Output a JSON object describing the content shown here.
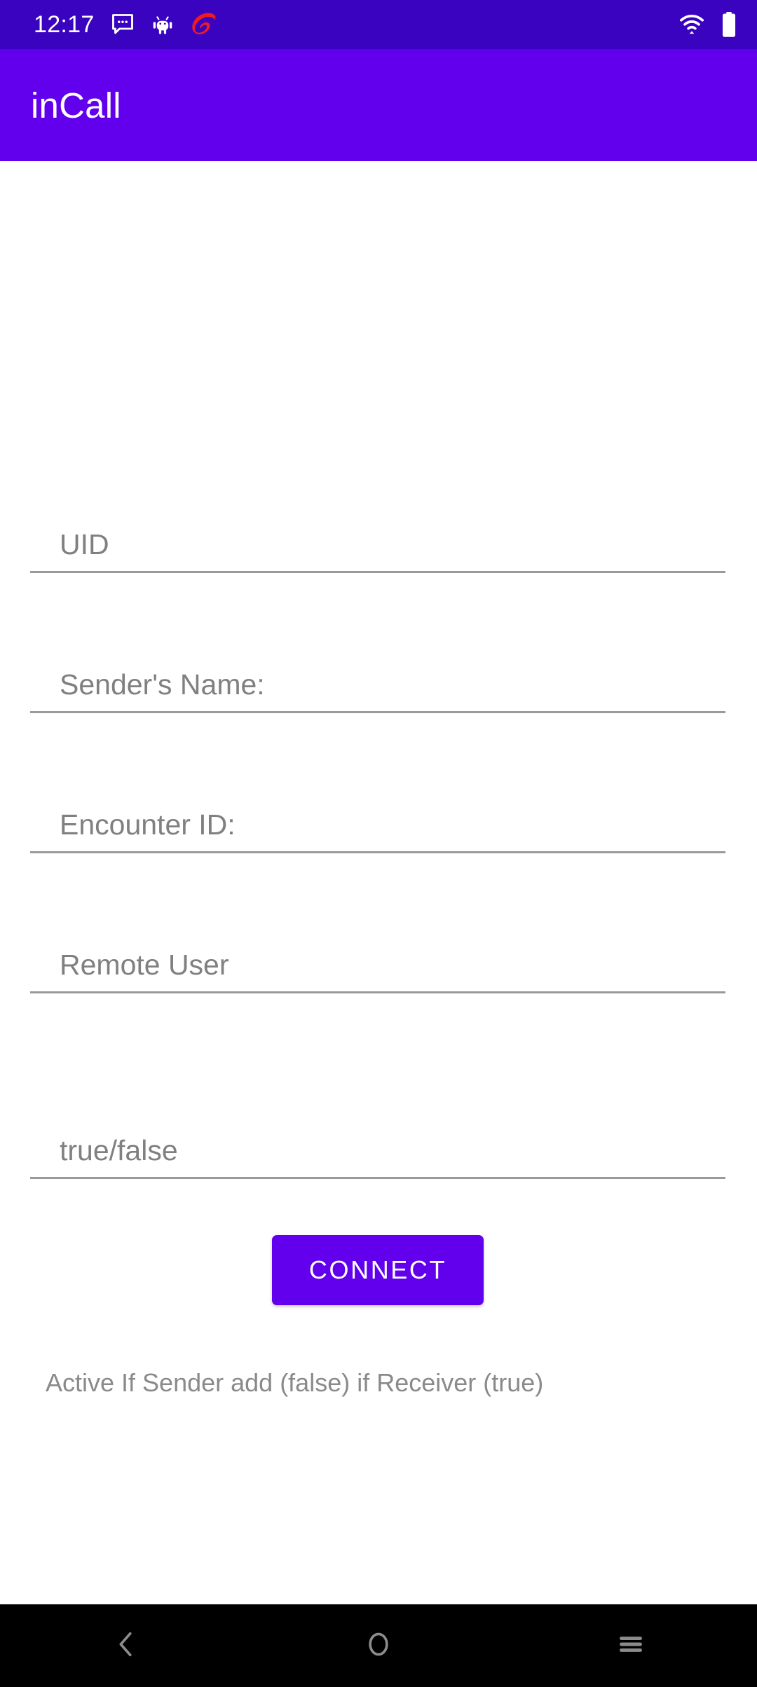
{
  "status_bar": {
    "clock": "12:17",
    "background_color": "#3A03BF",
    "left_icons": [
      {
        "name": "message-bubble-icon",
        "label": "messages"
      },
      {
        "name": "android-bug-icon",
        "label": "android debug"
      },
      {
        "name": "airtel-logo-icon",
        "label": "carrier logo",
        "color": "#ED1C24"
      }
    ],
    "right_icons": [
      {
        "name": "wifi-icon",
        "label": "wifi"
      },
      {
        "name": "battery-full-icon",
        "label": "battery full"
      }
    ]
  },
  "app_bar": {
    "title": "inCall",
    "background_color": "#6200EE",
    "title_color": "#FFFFFF"
  },
  "form": {
    "fields": [
      {
        "id": "uid",
        "placeholder": "UID",
        "value": ""
      },
      {
        "id": "sender_name",
        "placeholder": "Sender's Name:",
        "value": ""
      },
      {
        "id": "encounter_id",
        "placeholder": "Encounter ID:",
        "value": ""
      },
      {
        "id": "remote_user",
        "placeholder": "Remote User",
        "value": ""
      },
      {
        "id": "active_flag",
        "placeholder": "true/false",
        "value": ""
      }
    ],
    "helper_text": "Active If Sender add (false) if Receiver (true)",
    "placeholder_color": "#808080",
    "underline_color": "#9A9A9A"
  },
  "actions": {
    "connect_label": "CONNECT",
    "connect_color": "#6200EE",
    "connect_text_color": "#FFFFFF"
  },
  "nav_bar": {
    "background_color": "#000000",
    "icon_color": "#8C8C8C",
    "buttons": [
      {
        "name": "back-icon",
        "label": "Back"
      },
      {
        "name": "home-icon",
        "label": "Home"
      },
      {
        "name": "recents-icon",
        "label": "Recents"
      }
    ]
  }
}
